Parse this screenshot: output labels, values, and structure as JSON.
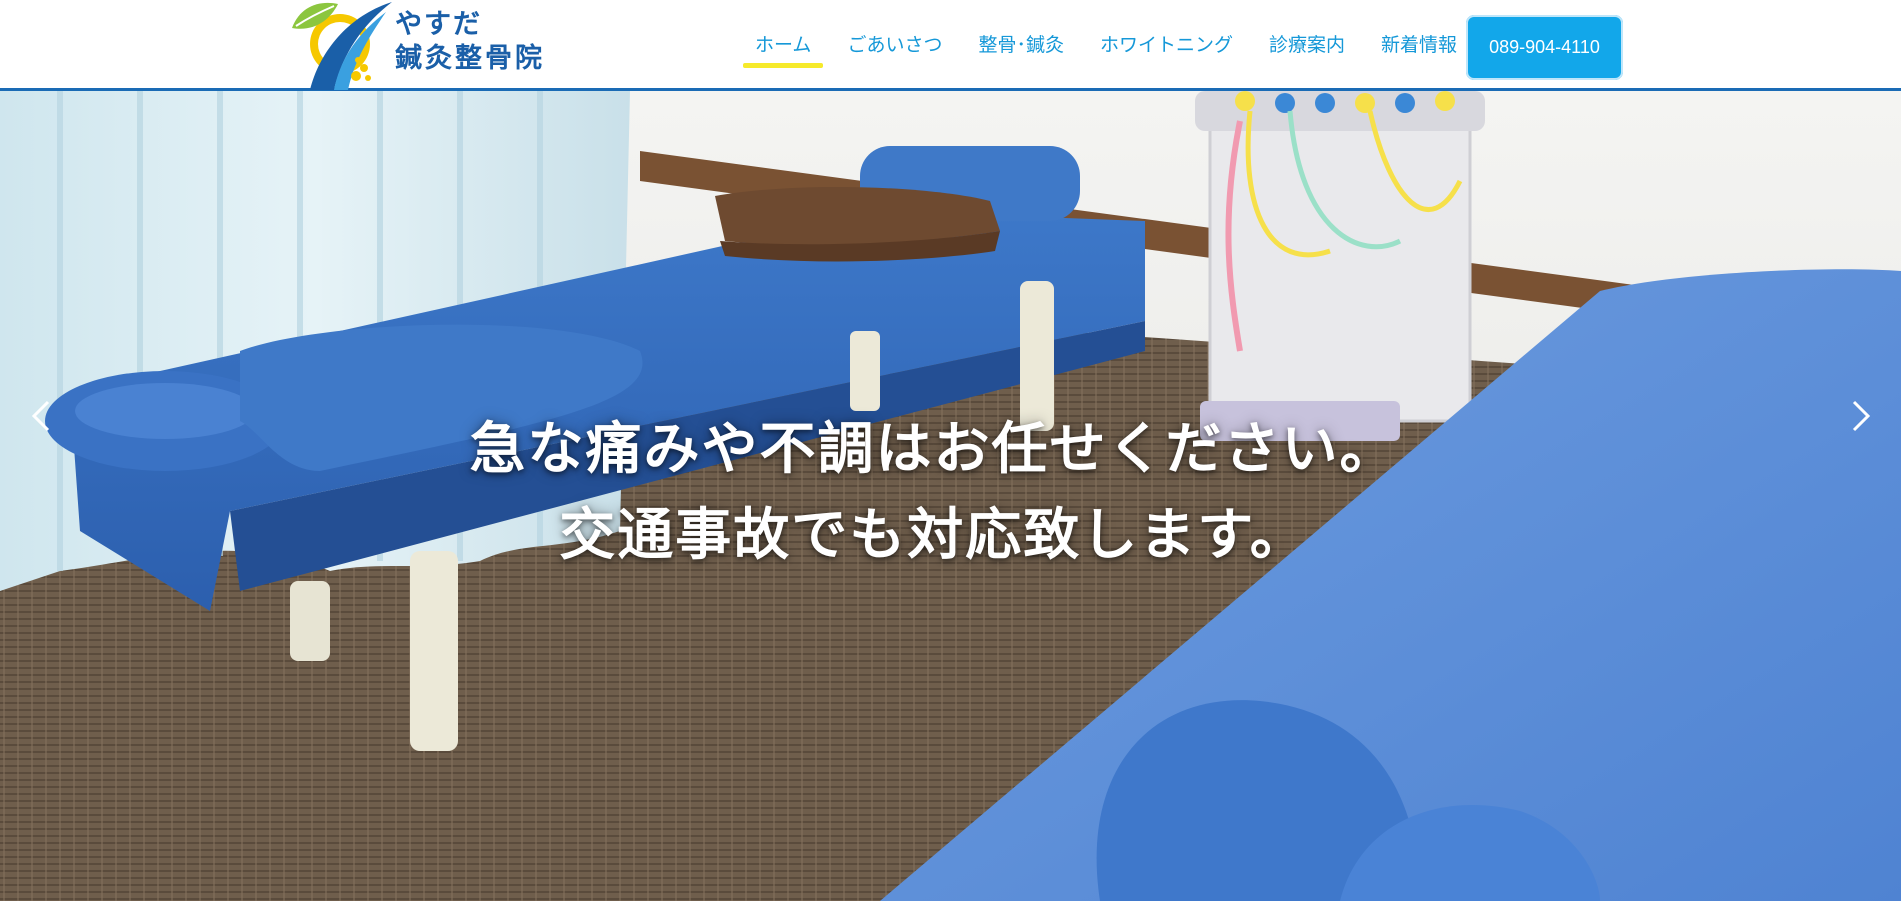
{
  "brand": {
    "name_line1": "やすだ",
    "name_line2": "鍼灸整骨院",
    "colors": {
      "primary": "#1a5fa8",
      "leaf": "#8cc63f",
      "sun": "#f6c800"
    }
  },
  "nav": {
    "items": [
      {
        "label": "ホーム",
        "active": true
      },
      {
        "label": "ごあいさつ",
        "active": false
      },
      {
        "label": "整骨･鍼灸",
        "active": false
      },
      {
        "label": "ホワイトニング",
        "active": false
      },
      {
        "label": "診療案内",
        "active": false
      },
      {
        "label": "新着情報",
        "active": false
      }
    ],
    "phone": "089-904-4110",
    "colors": {
      "link": "#1598d8",
      "active_underline": "#f6ea2b",
      "phone_bg": "#12a7ea",
      "header_border": "#1a6bb5"
    }
  },
  "hero": {
    "caption_line1": "急な痛みや不調はお任せください。",
    "caption_line2": "交通事故でも対応致します。",
    "prev_icon": "chevron-left-icon",
    "next_icon": "chevron-right-icon"
  }
}
